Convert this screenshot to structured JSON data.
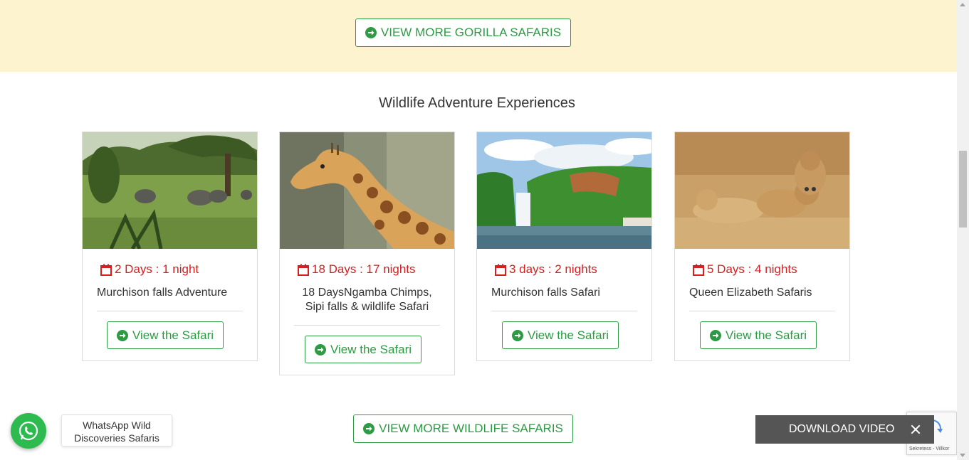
{
  "top_section": {
    "button_label": "VIEW MORE GORILLA SAFARIS",
    "background": "#fdf3cf"
  },
  "wildlife_section": {
    "title": "Wildlife Adventure Experiences",
    "cards": [
      {
        "duration": "2 Days : 1 night",
        "title": "Murchison falls Adventure",
        "button_label": "View the Safari",
        "image": "elephants-savanna"
      },
      {
        "duration": "18 Days : 17 nights",
        "title": "18 DaysNgamba Chimps, Sipi falls & wildlife Safari",
        "button_label": "View the Safari",
        "image": "giraffe"
      },
      {
        "duration": "3 days : 2 nights",
        "title": "Murchison falls Safari",
        "button_label": "View the Safari",
        "image": "waterfall-river"
      },
      {
        "duration": "5 Days : 4 nights",
        "title": "Queen Elizabeth Safaris",
        "button_label": "View the Safari",
        "image": "lions-grass"
      }
    ],
    "more_button_label": "VIEW MORE WILDLIFE SAFARIS"
  },
  "whatsapp": {
    "label": "WhatsApp Wild Discoveries Safaris",
    "icon": "whatsapp-icon",
    "color": "#2dba4e"
  },
  "download_bar": {
    "label": "DOWNLOAD VIDEO",
    "close_icon": "close-icon"
  },
  "recaptcha": {
    "text": "Sekretess - Villkor"
  },
  "colors": {
    "accent_green": "#2e9a44",
    "duration_red": "#d62020"
  }
}
